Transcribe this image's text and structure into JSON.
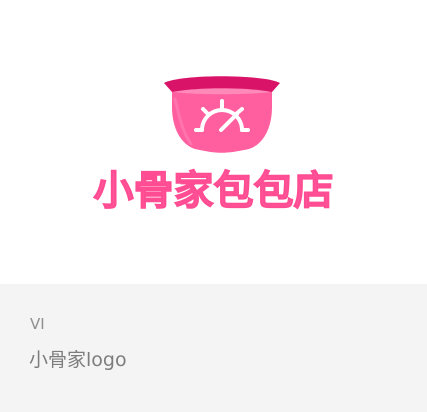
{
  "logo": {
    "brand_text": "小骨家包包店",
    "icon": "pink-basket-logo-icon",
    "colors": {
      "primary_pink": "#ff5f9f",
      "dark_pink": "#d91468",
      "light_pink": "#ff91bd",
      "white": "#ffffff"
    }
  },
  "caption": {
    "category": "VI",
    "title": "小骨家logo"
  },
  "colors": {
    "caption_background": "#f4f4f4",
    "caption_text": "#8f8f8f",
    "title_text": "#7d7d7d"
  }
}
